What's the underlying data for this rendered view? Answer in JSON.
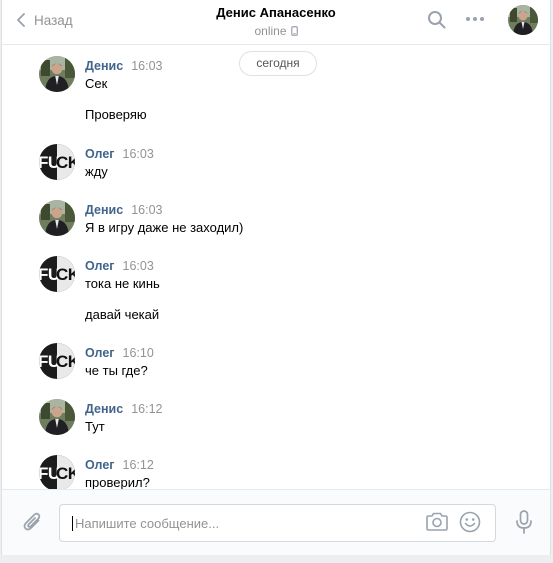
{
  "header": {
    "back_label": "Назад",
    "title": "Денис Апанасенко",
    "status": "online"
  },
  "date_separator": "сегодня",
  "messages": [
    {
      "author": "Денис",
      "time": "16:03",
      "avatar": "denis",
      "lines": [
        "Сек",
        "Проверяю"
      ]
    },
    {
      "author": "Олег",
      "time": "16:03",
      "avatar": "oleg",
      "lines": [
        "жду"
      ]
    },
    {
      "author": "Денис",
      "time": "16:03",
      "avatar": "denis",
      "lines": [
        "Я в игру даже не заходил)"
      ]
    },
    {
      "author": "Олег",
      "time": "16:03",
      "avatar": "oleg",
      "lines": [
        "тока не кинь",
        "давай чекай"
      ]
    },
    {
      "author": "Олег",
      "time": "16:10",
      "avatar": "oleg",
      "lines": [
        "че ты где?"
      ]
    },
    {
      "author": "Денис",
      "time": "16:12",
      "avatar": "denis",
      "lines": [
        "Тут"
      ]
    },
    {
      "author": "Олег",
      "time": "16:12",
      "avatar": "oleg",
      "lines": [
        "проверил?"
      ]
    }
  ],
  "composer": {
    "placeholder": "Напишите сообщение..."
  },
  "avatar_text": {
    "oleg": "FUCK"
  },
  "colors": {
    "author": "#42648b",
    "muted": "#939393",
    "border": "#e7e8ec",
    "icon": "#99a2ad"
  }
}
